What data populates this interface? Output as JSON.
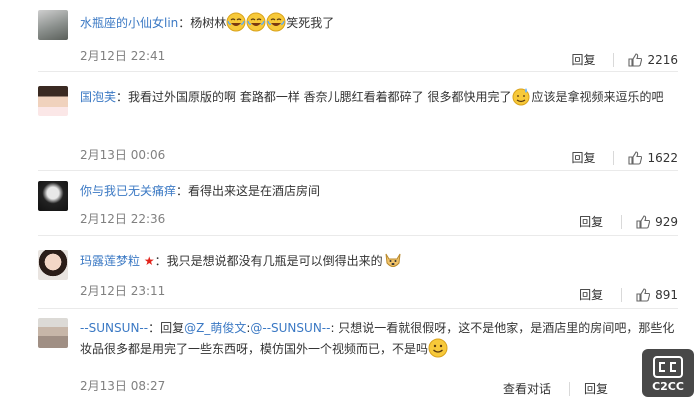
{
  "comments": [
    {
      "username": "水瓶座的小仙女lin",
      "before_emoji": "：杨树林",
      "after_emoji": "笑死我了",
      "date": "2月12日 22:41",
      "reply": "回复",
      "likes": "2216"
    },
    {
      "username": "国泡芙",
      "before_emoji": "：我看过外国原版的啊 套路都一样 香奈儿腮红看着都碎了 很多都快用完了",
      "after_emoji": "应该是拿视频来逗乐的吧",
      "date": "2月13日 00:06",
      "reply": "回复",
      "likes": "1622"
    },
    {
      "username": "你与我已无关痛痒",
      "text": "：看得出来这是在酒店房间",
      "date": "2月12日 22:36",
      "reply": "回复",
      "likes": "929"
    },
    {
      "username": "玛露莲梦粒",
      "text": "：我只是想说都没有几瓶是可以倒得出来的",
      "date": "2月12日 23:11",
      "reply": "回复",
      "likes": "891"
    },
    {
      "username": "--SUNSUN--",
      "reply_prefix": "：回复",
      "mention_1": "@Z_萌俊文",
      "colon": ":",
      "mention_2": "@--SUNSUN--",
      "body": ": 只想说一看就很假呀，这不是他家，是酒店里的房间吧，那些化妆品很多都是用完了一些东西呀，模仿国外一个视频而已，不是吗",
      "date": "2月13日 08:27",
      "view_conversation": "查看对话",
      "reply": "回复"
    }
  ],
  "watermark": {
    "text": "C2CC"
  },
  "colors": {
    "link": "#3b79c4",
    "meta": "#808080",
    "star": "#e2231a"
  }
}
